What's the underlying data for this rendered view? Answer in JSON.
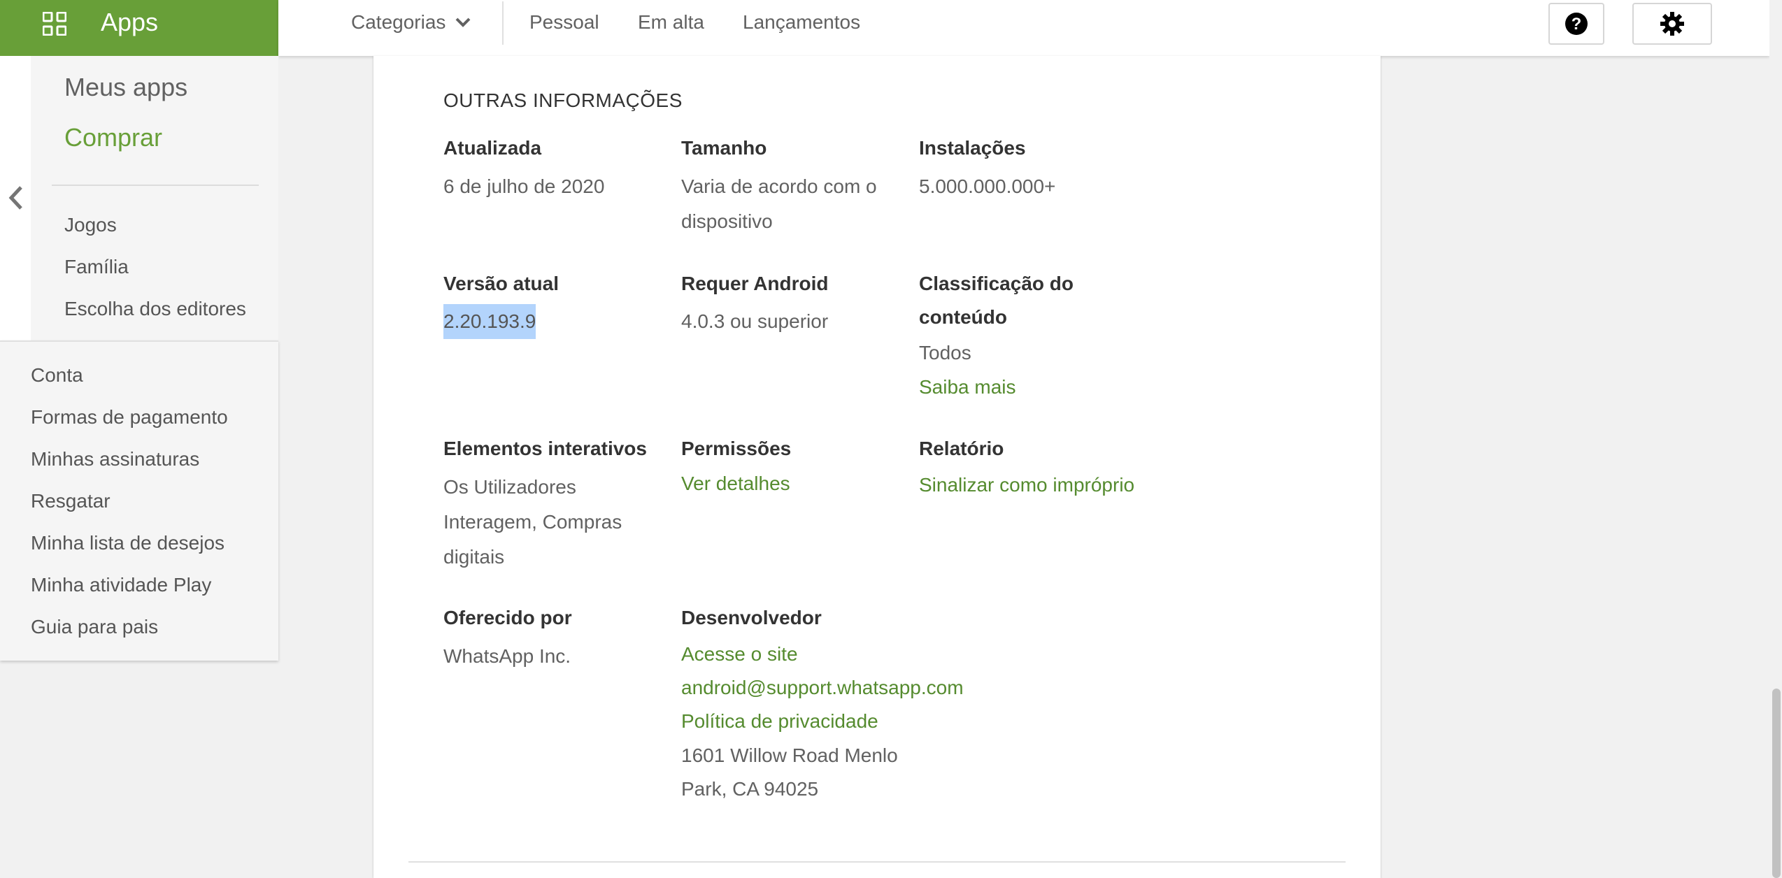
{
  "header": {
    "apps_label": "Apps",
    "nav": {
      "categories": "Categorias",
      "links": [
        "Pessoal",
        "Em alta",
        "Lançamentos"
      ]
    },
    "icons": [
      "apps-grid-icon",
      "chevron-down-icon",
      "help-icon",
      "gear-icon"
    ]
  },
  "sidebar": {
    "primary": [
      "Meus apps",
      "Comprar"
    ],
    "categories": [
      "Jogos",
      "Família",
      "Escolha dos editores"
    ],
    "account": [
      "Conta",
      "Formas de pagamento",
      "Minhas assinaturas",
      "Resgatar",
      "Minha lista de desejos",
      "Minha atividade Play",
      "Guia para pais"
    ]
  },
  "info": {
    "heading": "OUTRAS INFORMAÇÕES",
    "updated": {
      "title": "Atualizada",
      "value": "6 de julho de 2020"
    },
    "size": {
      "title": "Tamanho",
      "value_1": "Varia de acordo com o",
      "value_2": "dispositivo"
    },
    "installs": {
      "title": "Instalações",
      "value": "5.000.000.000+"
    },
    "version": {
      "title": "Versão atual",
      "value": "2.20.193.9"
    },
    "requires": {
      "title": "Requer Android",
      "value": "4.0.3 ou superior"
    },
    "rating": {
      "title_1": "Classificação do",
      "title_2": "conteúdo",
      "value": "Todos",
      "link": "Saiba mais"
    },
    "interactive": {
      "title": "Elementos interativos",
      "value_1": "Os Utilizadores",
      "value_2": "Interagem, Compras",
      "value_3": "digitais"
    },
    "permissions": {
      "title": "Permissões",
      "link": "Ver detalhes"
    },
    "report": {
      "title": "Relatório",
      "link": "Sinalizar como impróprio"
    },
    "offered_by": {
      "title": "Oferecido por",
      "value": "WhatsApp Inc."
    },
    "developer": {
      "title": "Desenvolvedor",
      "site_link": "Acesse o site",
      "email_link": "android@support.whatsapp.com",
      "privacy_link": "Política de privacidade",
      "address_1": "1601 Willow Road Menlo",
      "address_2": "Park, CA 94025"
    }
  },
  "colors": {
    "brand_green": "#689f38",
    "link_green": "#558b2f",
    "selection": "#b3d4fc"
  }
}
